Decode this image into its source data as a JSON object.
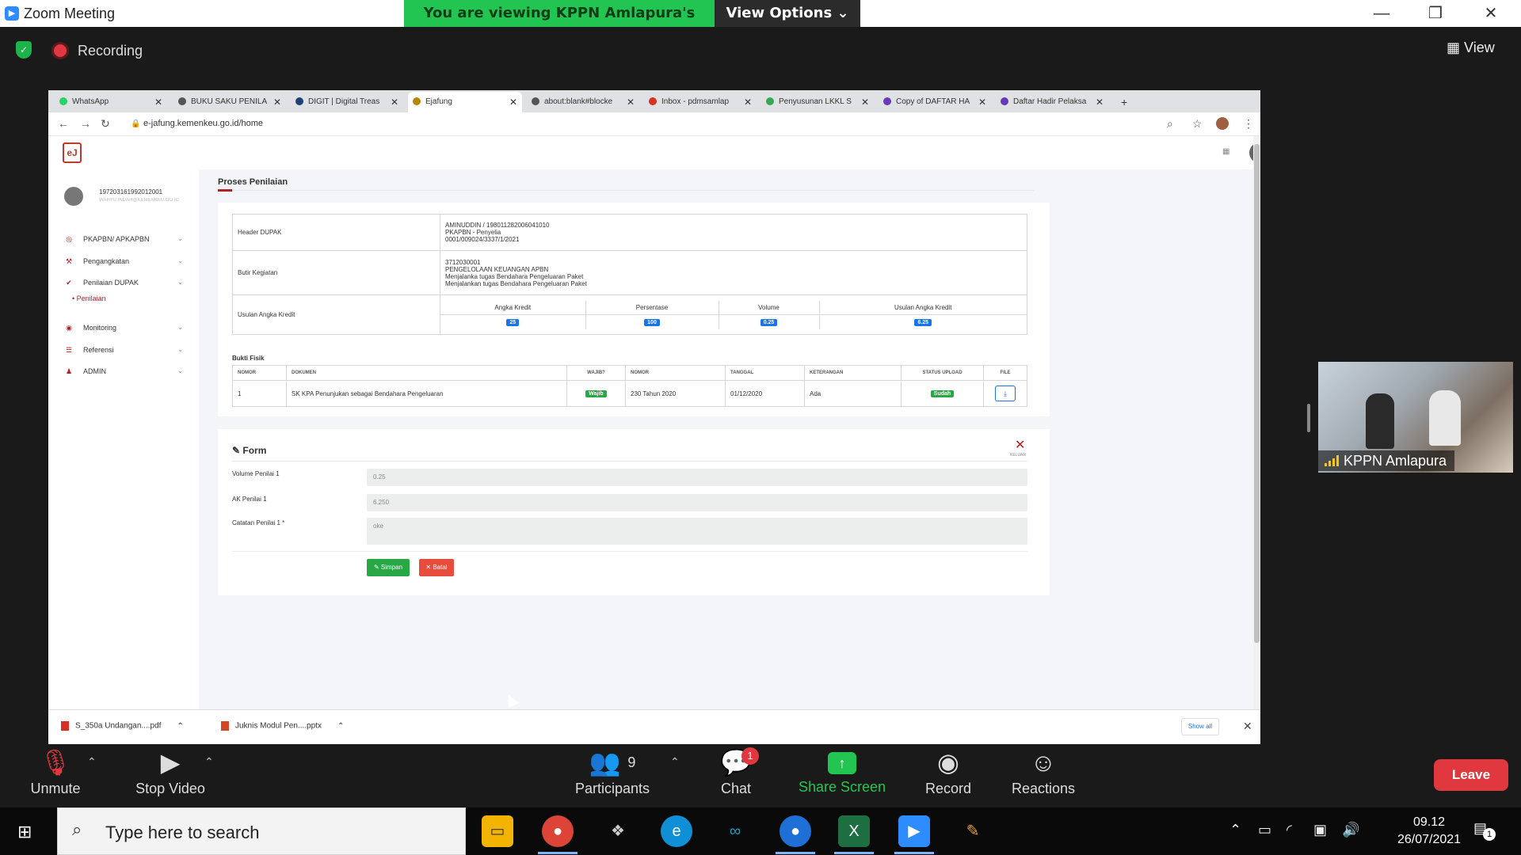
{
  "zoom": {
    "window_title": "Zoom Meeting",
    "viewing_banner": "You are viewing KPPN Amlapura's screen",
    "view_options": "View Options ⌄",
    "recording": "Recording",
    "view": "View",
    "participant_name": "KPPN Amlapura",
    "toolbar": {
      "unmute": "Unmute",
      "stop_video": "Stop Video",
      "participants": "Participants",
      "participants_count": "9",
      "chat": "Chat",
      "chat_badge": "1",
      "share_screen": "Share Screen",
      "record": "Record",
      "reactions": "Reactions",
      "leave": "Leave"
    }
  },
  "browser": {
    "tabs": [
      {
        "label": "WhatsApp",
        "color": "#25d366"
      },
      {
        "label": "BUKU SAKU PENILA",
        "color": "#555555"
      },
      {
        "label": "DIGIT | Digital Treas",
        "color": "#1f3f7a"
      },
      {
        "label": "Ejafung",
        "color": "#b8860b"
      },
      {
        "label": "about:blank#blocke",
        "color": "#555555"
      },
      {
        "label": "Inbox - pdmsamlap",
        "color": "#d93025"
      },
      {
        "label": "Penyusunan LKKL S",
        "color": "#34a853"
      },
      {
        "label": "Copy of DAFTAR HA",
        "color": "#673ab7"
      },
      {
        "label": "Daftar Hadir Pelaksa",
        "color": "#673ab7"
      }
    ],
    "url": "e-jafung.kemenkeu.go.id/home",
    "downloads": [
      {
        "name": "S_350a Undangan....pdf"
      },
      {
        "name": "Juknis Modul Pen....pptx"
      }
    ],
    "show_all": "Show all"
  },
  "app": {
    "logo": "eJ",
    "user_nip": "197203161992012001",
    "user_email": "WAHYU.INDAH@KEMENKEU.GO.ID",
    "menu": [
      {
        "label": "PKAPBN/ APKAPBN",
        "icon": "target-icon"
      },
      {
        "label": "Pengangkatan",
        "icon": "hammer-icon"
      },
      {
        "label": "Penilaian DUPAK",
        "icon": "check-icon"
      },
      {
        "label": "Monitoring",
        "icon": "eye-icon"
      },
      {
        "label": "Referensi",
        "icon": "list-icon"
      },
      {
        "label": "ADMIN",
        "icon": "user-icon"
      }
    ],
    "submenu_active": "Penilaian",
    "page_title": "Proses Penilaian",
    "header_dupak": {
      "label": "Header DUPAK",
      "lines": [
        "AMINUDDIN / 198011282006041010",
        "PKAPBN - Penyelia",
        "0001/009024/3337/1/2021"
      ]
    },
    "butir_kegiatan": {
      "label": "Butir Kegiatan",
      "lines": [
        "3712030001",
        "PENGELOLAAN KEUANGAN APBN",
        "Menjalanka tugas Bendahara Pengeluaran Paket",
        "Menjalankan tugas Bendahara Pengeluaran Paket"
      ]
    },
    "usulan": {
      "label": "Usulan Angka Kredit",
      "headers": [
        "Angka Kredit",
        "Persentase",
        "Volume",
        "Usulan Angka Kredit"
      ],
      "values": [
        "25",
        "100",
        "0.25",
        "6.25"
      ]
    },
    "bukti_fisik": {
      "title": "Bukti Fisik",
      "headers": [
        "NOMOR",
        "DOKUMEN",
        "WAJIB?",
        "NOMOR",
        "TANGGAL",
        "KETERANGAN",
        "STATUS UPLOAD",
        "FILE"
      ],
      "row": {
        "nomor": "1",
        "dokumen": "SK KPA Penunjukan sebagai Bendahara Pengeluaran",
        "wajib": "Wajib",
        "nomor_dok": "230 Tahun 2020",
        "tanggal": "01/12/2020",
        "keterangan": "Ada",
        "status": "Sudah"
      }
    },
    "form": {
      "title": "Form",
      "close_label": "KELUAR",
      "volume_label": "Volume Penilai 1",
      "volume_value": "0.25",
      "ak_label": "AK Penilai 1",
      "ak_value": "6.250",
      "catatan_label": "Catatan Penilai 1 *",
      "catatan_value": "oke",
      "save": "✎ Simpan",
      "cancel": "✕ Batal"
    }
  },
  "taskbar": {
    "search_placeholder": "Type here to search",
    "time": "09.12",
    "date": "26/07/2021",
    "notifications": "1"
  }
}
